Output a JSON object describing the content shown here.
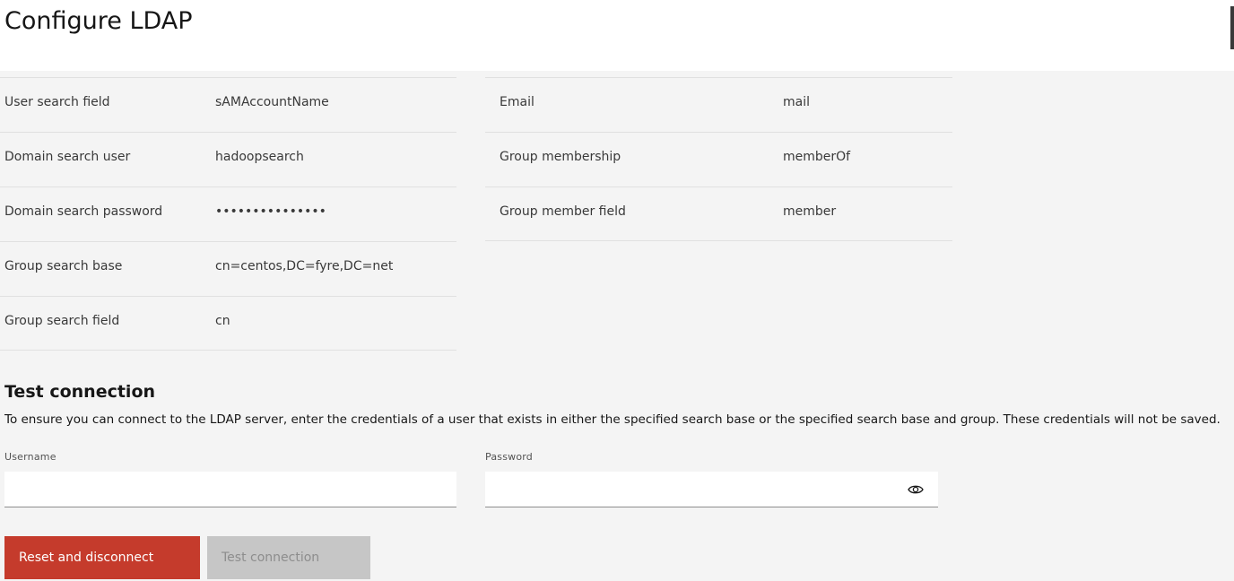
{
  "header": {
    "title": "Configure LDAP"
  },
  "settings_left": [
    {
      "label": "User search field",
      "value": "sAMAccountName"
    },
    {
      "label": "Domain search user",
      "value": "hadoopsearch"
    },
    {
      "label": "Domain search password",
      "value": "•••••••••••••••"
    },
    {
      "label": "Group search base",
      "value": "cn=centos,DC=fyre,DC=net"
    },
    {
      "label": "Group search field",
      "value": "cn"
    }
  ],
  "settings_right": [
    {
      "label": "Email",
      "value": "mail"
    },
    {
      "label": "Group membership",
      "value": "memberOf"
    },
    {
      "label": "Group member field",
      "value": "member"
    }
  ],
  "test_connection": {
    "title": "Test connection",
    "description": "To ensure you can connect to the LDAP server, enter the credentials of a user that exists in either the specified search base or the specified search base and group. These credentials will not be saved.",
    "username_label": "Username",
    "username_value": "",
    "password_label": "Password",
    "password_value": "",
    "password_toggle_icon": "eye-icon"
  },
  "actions": {
    "reset_label": "Reset and disconnect",
    "test_label": "Test connection"
  },
  "colors": {
    "danger": "#c53b2c",
    "disabled": "#c6c6c6",
    "background": "#f4f4f4"
  }
}
